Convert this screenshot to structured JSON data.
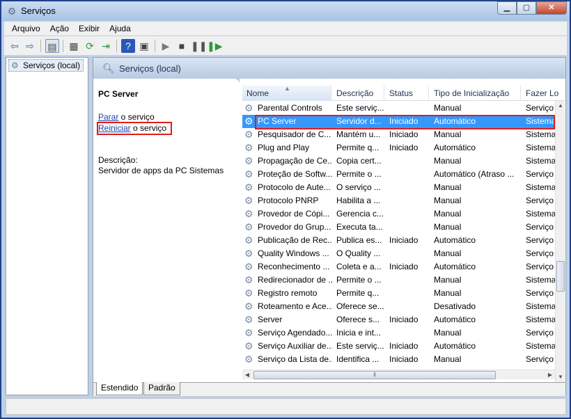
{
  "window": {
    "title": "Serviços"
  },
  "menu": [
    "Arquivo",
    "Ação",
    "Exibir",
    "Ajuda"
  ],
  "tree": {
    "root_label": "Serviços (local)"
  },
  "header": {
    "title": "Serviços (local)"
  },
  "details": {
    "service_name": "PC Server",
    "stop_link": "Parar",
    "stop_suffix": " o serviço",
    "restart_link": "Reiniciar",
    "restart_suffix": " o serviço",
    "description_label": "Descrição:",
    "description_text": "Servidor de apps da PC Sistemas"
  },
  "columns": [
    "Nome",
    "Descrição",
    "Status",
    "Tipo de Inicialização",
    "Fazer Lo"
  ],
  "rows": [
    {
      "name": "Parental Controls",
      "desc": "Este serviç...",
      "status": "",
      "startup": "Manual",
      "logon": "Serviço"
    },
    {
      "name": "PC Server",
      "desc": "Servidor d...",
      "status": "Iniciado",
      "startup": "Automático",
      "logon": "Sistema"
    },
    {
      "name": "Pesquisador de C...",
      "desc": "Mantém u...",
      "status": "Iniciado",
      "startup": "Manual",
      "logon": "Sistema"
    },
    {
      "name": "Plug and Play",
      "desc": "Permite q...",
      "status": "Iniciado",
      "startup": "Automático",
      "logon": "Sistema"
    },
    {
      "name": "Propagação de Ce...",
      "desc": "Copia cert...",
      "status": "",
      "startup": "Manual",
      "logon": "Sistema"
    },
    {
      "name": "Proteção de Softw...",
      "desc": "Permite o ...",
      "status": "",
      "startup": "Automático (Atraso ...",
      "logon": "Serviço"
    },
    {
      "name": "Protocolo de Aute...",
      "desc": "O serviço ...",
      "status": "",
      "startup": "Manual",
      "logon": "Sistema"
    },
    {
      "name": "Protocolo PNRP",
      "desc": "Habilita a ...",
      "status": "",
      "startup": "Manual",
      "logon": "Serviço"
    },
    {
      "name": "Provedor de Cópi...",
      "desc": "Gerencia c...",
      "status": "",
      "startup": "Manual",
      "logon": "Sistema"
    },
    {
      "name": "Provedor do Grup...",
      "desc": "Executa ta...",
      "status": "",
      "startup": "Manual",
      "logon": "Serviço"
    },
    {
      "name": "Publicação de Rec...",
      "desc": "Publica es...",
      "status": "Iniciado",
      "startup": "Automático",
      "logon": "Serviço"
    },
    {
      "name": "Quality Windows ...",
      "desc": "O Quality ...",
      "status": "",
      "startup": "Manual",
      "logon": "Serviço"
    },
    {
      "name": "Reconhecimento ...",
      "desc": "Coleta e a...",
      "status": "Iniciado",
      "startup": "Automático",
      "logon": "Serviço"
    },
    {
      "name": "Redirecionador de ...",
      "desc": "Permite o ...",
      "status": "",
      "startup": "Manual",
      "logon": "Sistema"
    },
    {
      "name": "Registro remoto",
      "desc": "Permite q...",
      "status": "",
      "startup": "Manual",
      "logon": "Serviço"
    },
    {
      "name": "Roteamento e Ace...",
      "desc": "Oferece se...",
      "status": "",
      "startup": "Desativado",
      "logon": "Sistema"
    },
    {
      "name": "Server",
      "desc": "Oferece s...",
      "status": "Iniciado",
      "startup": "Automático",
      "logon": "Sistema"
    },
    {
      "name": "Serviço Agendado...",
      "desc": "Inicia e int...",
      "status": "",
      "startup": "Manual",
      "logon": "Serviço"
    },
    {
      "name": "Serviço Auxiliar de...",
      "desc": "Este serviç...",
      "status": "Iniciado",
      "startup": "Automático",
      "logon": "Sistema"
    },
    {
      "name": "Serviço da Lista de...",
      "desc": "Identifica ...",
      "status": "Iniciado",
      "startup": "Manual",
      "logon": "Serviço"
    }
  ],
  "tabs": [
    "Estendido",
    "Padrão"
  ],
  "colors": {
    "selection": "#3399ff",
    "highlight_box": "#e21b1b",
    "link": "#1e3fa8"
  }
}
